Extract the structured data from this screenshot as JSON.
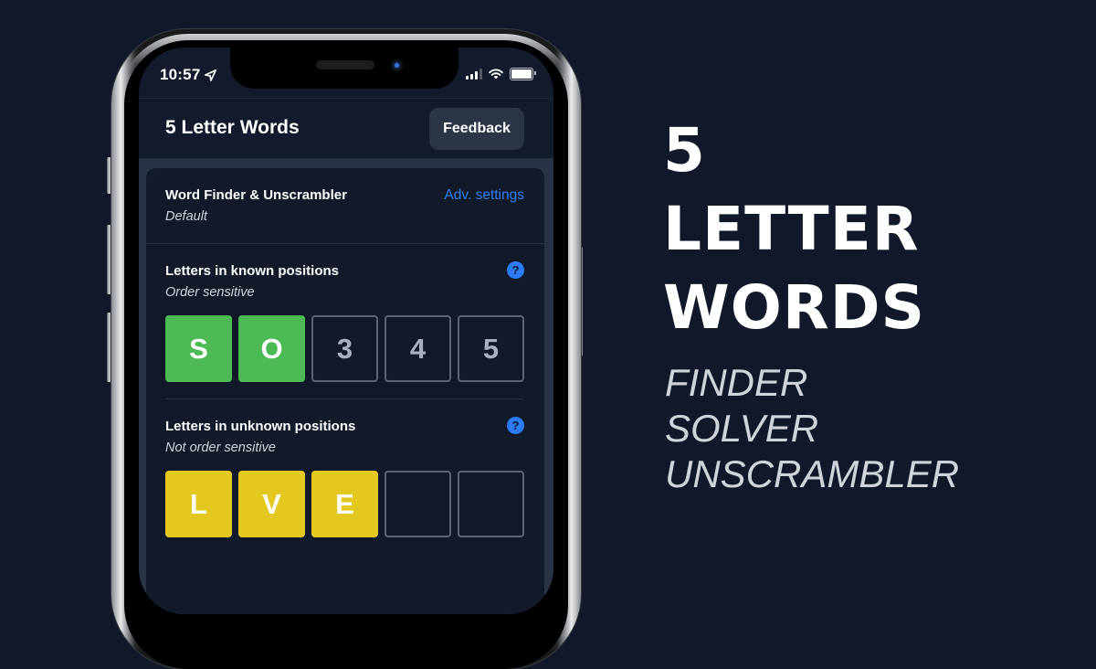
{
  "colors": {
    "background": "#10182a",
    "app_bg": "#131a2b",
    "card_bg": "#121a2a",
    "green": "#4cba55",
    "yellow": "#e2c81f",
    "link_blue": "#2f80ed",
    "help_blue": "#2b7cf6"
  },
  "status_bar": {
    "time": "10:57",
    "location_icon": "location-arrow-icon",
    "signal_icon": "cellular-signal-icon",
    "wifi_icon": "wifi-icon",
    "battery_icon": "battery-icon"
  },
  "app": {
    "title": "5 Letter Words",
    "feedback_label": "Feedback"
  },
  "finder": {
    "title": "Word Finder & Unscrambler",
    "subtitle": "Default",
    "adv_settings_label": "Adv. settings"
  },
  "known": {
    "title": "Letters in known positions",
    "subtitle": "Order sensitive",
    "help_icon": "?",
    "tiles": [
      {
        "text": "S",
        "state": "green"
      },
      {
        "text": "O",
        "state": "green"
      },
      {
        "text": "3",
        "state": "empty"
      },
      {
        "text": "4",
        "state": "empty"
      },
      {
        "text": "5",
        "state": "empty"
      }
    ]
  },
  "unknown": {
    "title": "Letters in unknown positions",
    "subtitle": "Not order sensitive",
    "help_icon": "?",
    "tiles": [
      {
        "text": "L",
        "state": "yellow"
      },
      {
        "text": "V",
        "state": "yellow"
      },
      {
        "text": "E",
        "state": "yellow"
      },
      {
        "text": "",
        "state": "empty"
      },
      {
        "text": "",
        "state": "empty"
      }
    ]
  },
  "promo": {
    "headline": [
      "5",
      "LETTER",
      "WORDS"
    ],
    "taglines": [
      "FINDER",
      "SOLVER",
      "UNSCRAMBLER"
    ]
  }
}
